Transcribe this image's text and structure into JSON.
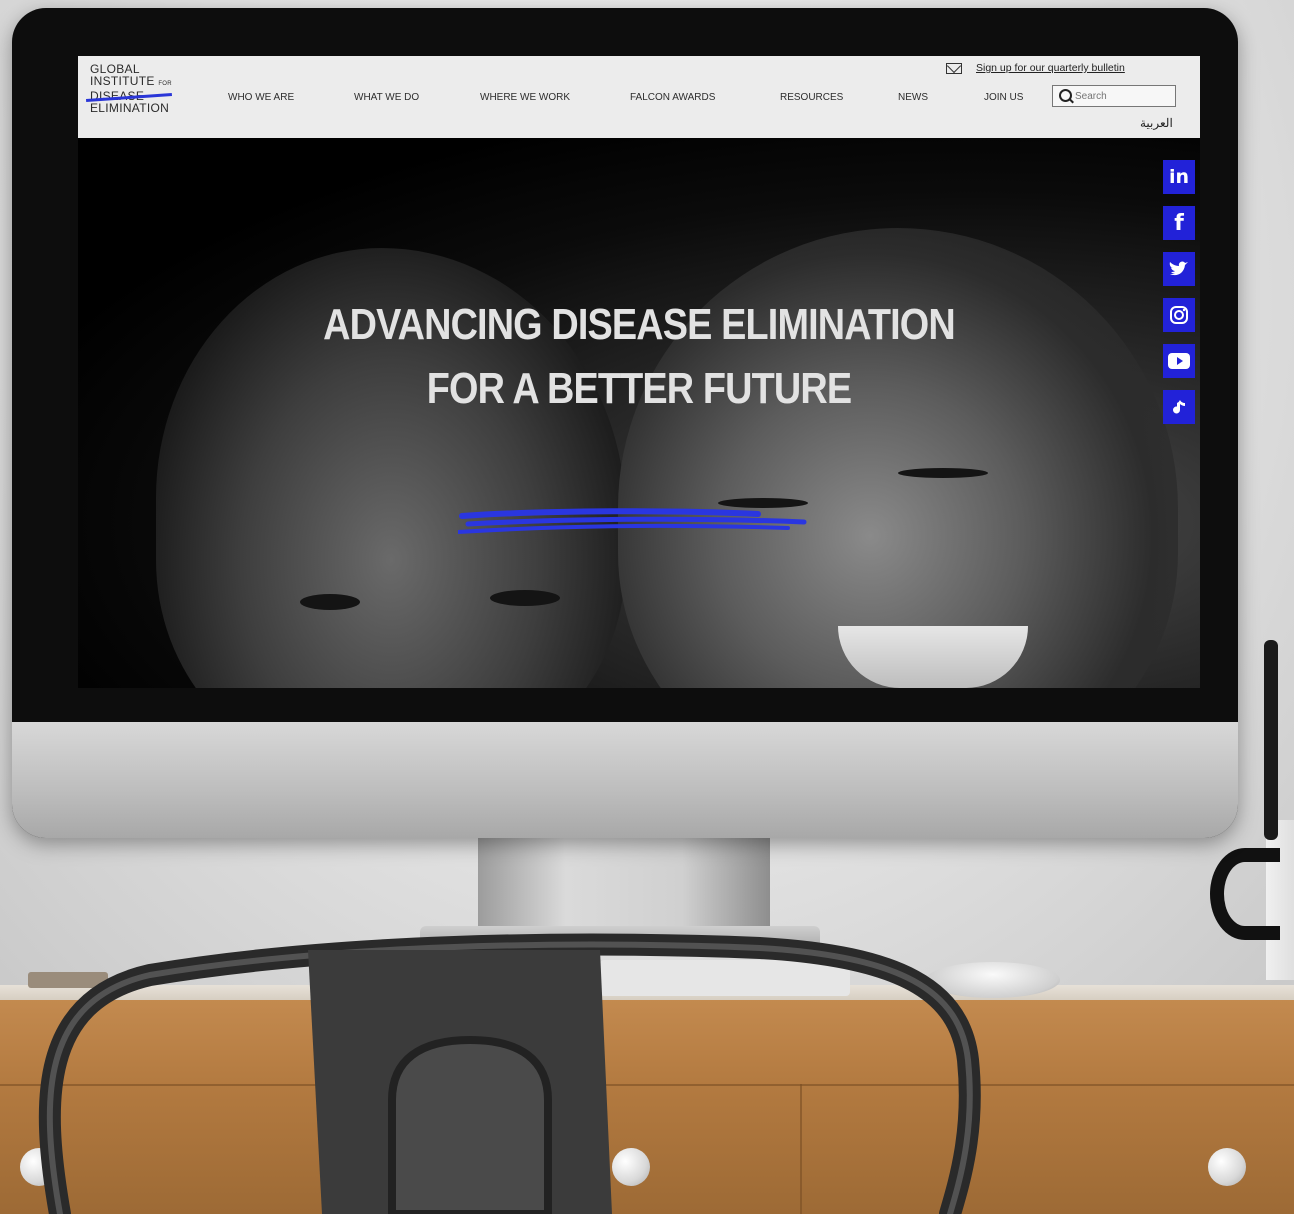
{
  "site": {
    "logo_lines": [
      "GLOBAL",
      "INSTITUTE",
      "DISEASE",
      "ELIMINATION"
    ],
    "logo_small": "FOR",
    "nav": [
      "WHO WE ARE",
      "WHAT WE DO",
      "WHERE WE WORK",
      "FALCON AWARDS",
      "RESOURCES",
      "NEWS",
      "JOIN US"
    ],
    "signup": "Sign up for our quarterly bulletin",
    "search_placeholder": "Search",
    "language": "العربية",
    "headline_line1": "ADVANCING DISEASE ELIMINATION",
    "headline_line2": "FOR A BETTER FUTURE",
    "social": [
      "linkedin-icon",
      "facebook-icon",
      "twitter-icon",
      "instagram-icon",
      "youtube-icon",
      "tiktok-icon"
    ]
  },
  "colors": {
    "accent": "#2222d8",
    "header_bg": "#ececec",
    "headline": "#e2e2e2",
    "desk": "#b37a40"
  }
}
